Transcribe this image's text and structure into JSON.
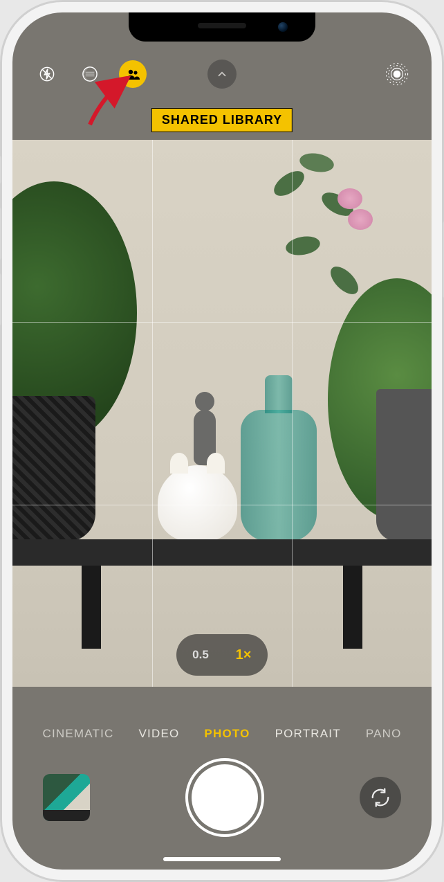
{
  "banner": {
    "label": "SHARED LIBRARY"
  },
  "top": {
    "flash_icon": "flash-off-icon",
    "night_icon": "night-mode-icon",
    "shared_icon": "shared-library-icon",
    "chevron_icon": "chevron-up-icon",
    "live_icon": "live-photo-icon"
  },
  "zoom": {
    "options": [
      {
        "label": "0.5",
        "active": false
      },
      {
        "label": "1×",
        "active": true
      }
    ]
  },
  "modes": [
    {
      "label": "CINEMATIC",
      "selected": false,
      "edge": true
    },
    {
      "label": "VIDEO",
      "selected": false,
      "edge": false
    },
    {
      "label": "PHOTO",
      "selected": true,
      "edge": false
    },
    {
      "label": "PORTRAIT",
      "selected": false,
      "edge": false
    },
    {
      "label": "PANO",
      "selected": false,
      "edge": true
    }
  ],
  "bottom": {
    "thumb": "last-photo-thumbnail",
    "shutter": "shutter-button",
    "flip": "flip-camera-button"
  },
  "colors": {
    "accent": "#f4c200",
    "bg": "#797670"
  }
}
